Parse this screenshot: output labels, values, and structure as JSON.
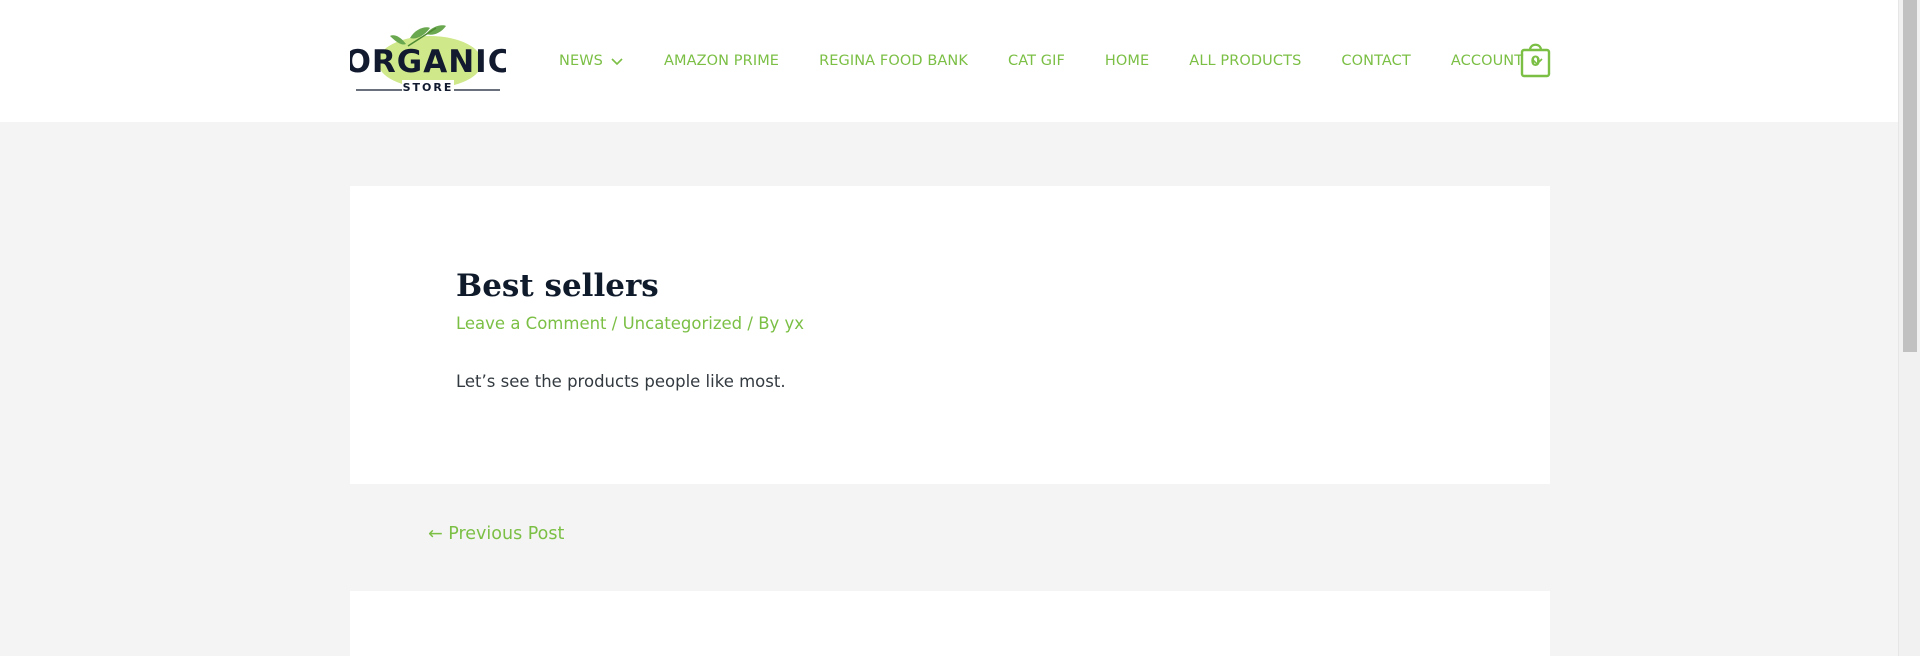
{
  "header": {
    "logo": {
      "word": "ORGANIC",
      "sub": "STORE",
      "icon": "leaf-icon"
    },
    "nav": [
      {
        "label": "NEWS",
        "has_dropdown": true
      },
      {
        "label": "AMAZON PRIME",
        "has_dropdown": false
      },
      {
        "label": "REGINA FOOD BANK",
        "has_dropdown": false
      },
      {
        "label": "CAT GIF",
        "has_dropdown": false
      },
      {
        "label": "HOME",
        "has_dropdown": false
      },
      {
        "label": "ALL PRODUCTS",
        "has_dropdown": false
      },
      {
        "label": "CONTACT",
        "has_dropdown": false
      },
      {
        "label": "ACCOUNT",
        "has_dropdown": true
      }
    ],
    "cart": {
      "count": "0",
      "icon": "shopping-bag-icon"
    }
  },
  "post": {
    "title": "Best sellers",
    "meta": {
      "comment_link": "Leave a Comment",
      "sep1": " / ",
      "category": "Uncategorized",
      "sep2": " / By ",
      "author": "yx"
    },
    "body": "Let’s see the products people like most."
  },
  "navigation": {
    "previous_label": "← Previous Post"
  },
  "colors": {
    "accent": "#7bbf45",
    "title": "#0f1b2b",
    "background": "#f4f4f4",
    "card": "#ffffff"
  }
}
